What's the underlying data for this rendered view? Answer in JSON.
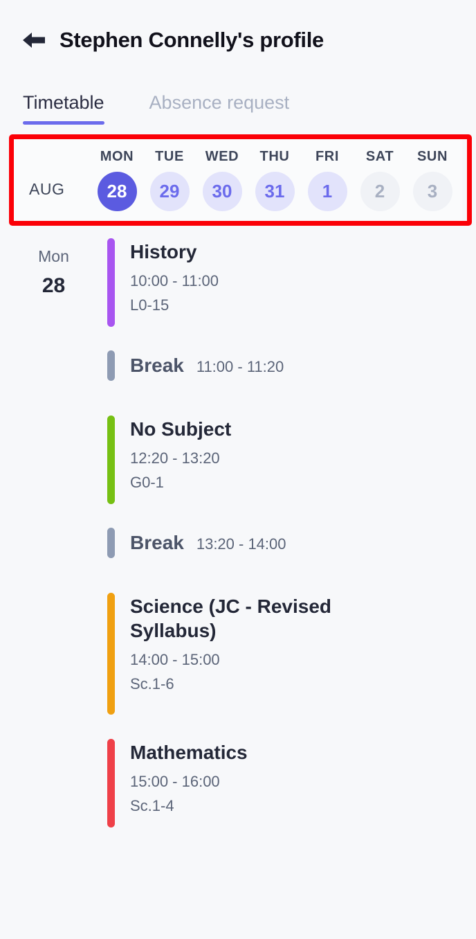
{
  "header": {
    "back_icon": "arrow-left-icon",
    "title": "Stephen Connelly's profile"
  },
  "tabs": [
    {
      "label": "Timetable",
      "active": true
    },
    {
      "label": "Absence request",
      "active": false
    }
  ],
  "date_strip": {
    "month": "AUG",
    "highlight_color": "#fb0007",
    "selected_color": "#5b5be0",
    "available_color": "#e2e3fb",
    "days": [
      {
        "dow": "MON",
        "num": "28",
        "state": "selected"
      },
      {
        "dow": "TUE",
        "num": "29",
        "state": "available"
      },
      {
        "dow": "WED",
        "num": "30",
        "state": "available"
      },
      {
        "dow": "THU",
        "num": "31",
        "state": "available"
      },
      {
        "dow": "FRI",
        "num": "1",
        "state": "available"
      },
      {
        "dow": "SAT",
        "num": "2",
        "state": "disabled"
      },
      {
        "dow": "SUN",
        "num": "3",
        "state": "disabled"
      }
    ]
  },
  "timetable": {
    "gutter": {
      "dow": "Mon",
      "num": "28"
    },
    "entries": [
      {
        "type": "lesson",
        "title": "History",
        "time": "10:00 - 11:00",
        "room": "L0-15",
        "color": "#a855f0"
      },
      {
        "type": "break",
        "title": "Break",
        "time": "11:00 - 11:20",
        "room": "",
        "color": "#8e9bb3"
      },
      {
        "type": "lesson",
        "title": "No Subject",
        "time": "12:20 - 13:20",
        "room": "G0-1",
        "color": "#76c013"
      },
      {
        "type": "break",
        "title": "Break",
        "time": "13:20 - 14:00",
        "room": "",
        "color": "#8e9bb3"
      },
      {
        "type": "lesson",
        "title": "Science (JC - Revised Syllabus)",
        "time": "14:00 - 15:00",
        "room": "Sc.1-6",
        "color": "#f0a011"
      },
      {
        "type": "lesson",
        "title": "Mathematics",
        "time": "15:00 - 16:00",
        "room": "Sc.1-4",
        "color": "#ef4048"
      }
    ]
  }
}
